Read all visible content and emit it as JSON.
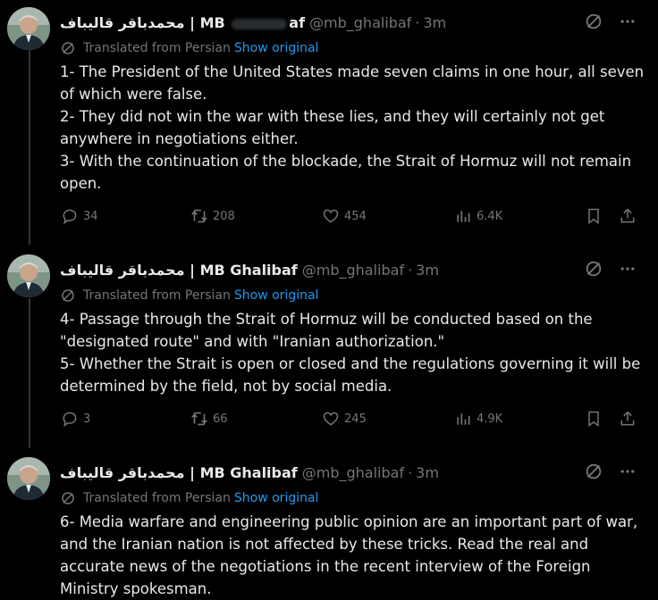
{
  "author": {
    "display_name": "محمدباقر قالیباف | MB Ghalibaf",
    "display_name_first": "محمدباقر قالیباف | MB",
    "display_name_end": "af",
    "handle": "@mb_ghalibaf",
    "separator": "·",
    "time": "3m"
  },
  "translation": {
    "label": "Translated from Persian",
    "link": "Show original"
  },
  "icons": {
    "grok": "grok-icon",
    "more": "more-icon",
    "translate": "translate-icon",
    "reply": "reply-icon",
    "retweet": "retweet-icon",
    "like": "heart-icon",
    "views": "views-icon",
    "bookmark": "bookmark-icon",
    "share": "share-icon"
  },
  "colors": {
    "background": "#000000",
    "text": "#e7e9ea",
    "muted": "#71767b",
    "link": "#1d9bf0",
    "thread_line": "#333639"
  },
  "tweets": [
    {
      "paragraphs": [
        "1- The President of the United States made seven claims in one hour, all seven of which were false.",
        "2- They did not win the war with these lies, and they will certainly not get anywhere in negotiations either.",
        "3- With the continuation of the blockade, the Strait of Hormuz will not remain open."
      ],
      "replies": "34",
      "retweets": "208",
      "likes": "454",
      "views": "6.4K"
    },
    {
      "paragraphs": [
        "4- Passage through the Strait of Hormuz will be conducted based on the \"designated route\" and with \"Iranian authorization.\"",
        "5- Whether the Strait is open or closed and the regulations governing it will be determined by the field, not by social media."
      ],
      "replies": "3",
      "retweets": "66",
      "likes": "245",
      "views": "4.9K"
    },
    {
      "paragraphs": [
        "6- Media warfare and engineering public opinion are an important part of war, and the Iranian nation is not affected by these tricks. Read the real and accurate news of the negotiations in the recent interview of the Foreign Ministry spokesman."
      ]
    }
  ]
}
